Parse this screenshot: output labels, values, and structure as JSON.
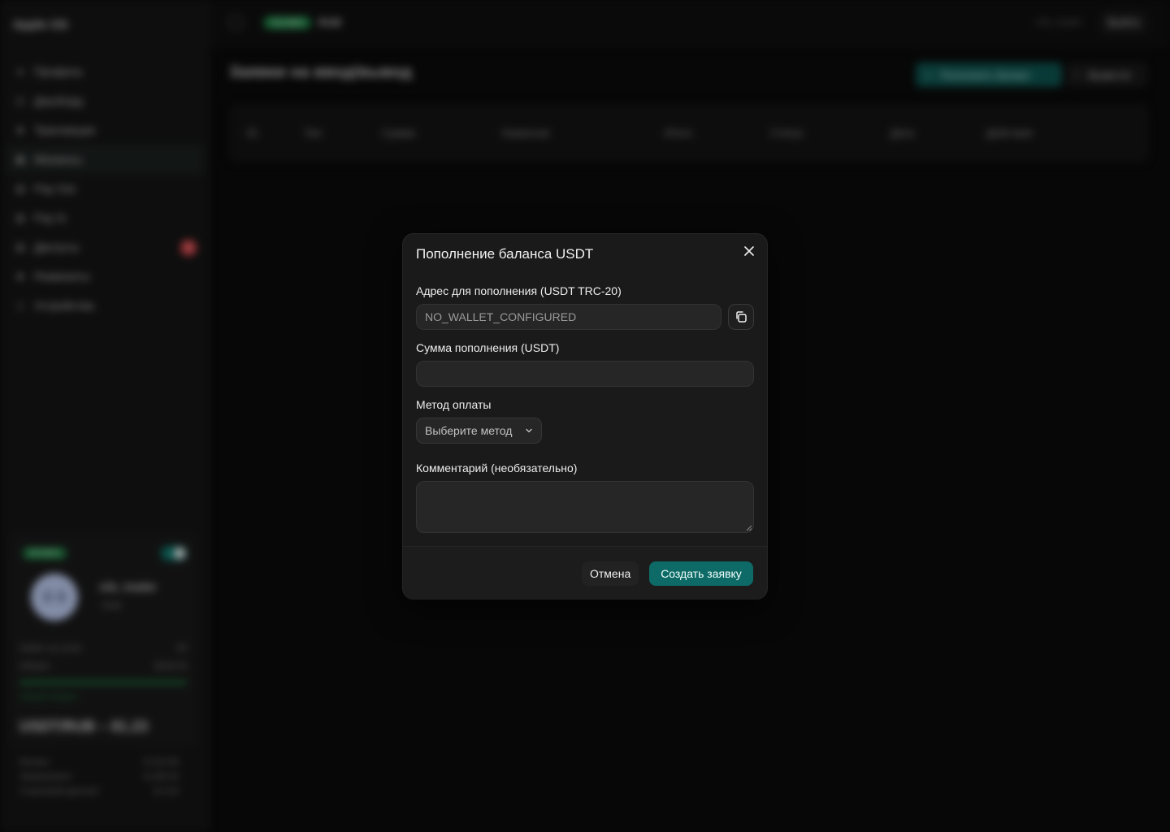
{
  "sidebar": {
    "brand": "Apple OS",
    "items": [
      {
        "label": "Профиль",
        "icon": "user-icon"
      },
      {
        "label": "Дашборд",
        "icon": "dashboard-icon"
      },
      {
        "label": "Транзакции",
        "icon": "transactions-icon"
      },
      {
        "label": "Финансы",
        "icon": "finance-icon",
        "active": true
      },
      {
        "label": "Pay Out",
        "icon": "payout-icon"
      },
      {
        "label": "Pay In",
        "icon": "payin-icon"
      },
      {
        "label": "Диспуты",
        "icon": "dispute-icon",
        "badge": "3"
      },
      {
        "label": "Реквизиты",
        "icon": "requisites-icon"
      },
      {
        "label": "Устройства",
        "icon": "devices-icon"
      }
    ],
    "user_card": {
      "status": "Активен",
      "avatar_initials": "S S",
      "username": "s3s_trader",
      "role": "RUB",
      "rows": [
        {
          "label": "Лимит за сутки",
          "value": "83"
        },
        {
          "label": "Оборот",
          "value": "$226.05"
        }
      ],
      "progress_text": "Новый оборот",
      "rate": "USDT/RUB – 81.23"
    },
    "bottom_stats": [
      {
        "label": "Баланс",
        "value": "$ 323.89"
      },
      {
        "label": "Заморожено",
        "value": "$ 189.00"
      },
      {
        "label": "Страховой депозит",
        "value": "$ 0.00"
      }
    ]
  },
  "topbar": {
    "status_pill": "Онлайн",
    "currency": "RUB",
    "user": "s3s_trader",
    "logout": "Выйти"
  },
  "main": {
    "title": "Заявки на ввод/вывод",
    "topup_button": "Пополнить баланс",
    "withdraw_button": "Вывести",
    "table_headers": [
      "ID",
      "Тип",
      "Сумма",
      "Комиссия",
      "Итого",
      "Статус",
      "Дата",
      "Действия"
    ]
  },
  "modal": {
    "title": "Пополнение баланса USDT",
    "address_label": "Адрес для пополнения (USDT TRC-20)",
    "address_value": "NO_WALLET_CONFIGURED",
    "amount_label": "Сумма пополнения (USDT)",
    "amount_value": "",
    "method_label": "Метод оплаты",
    "method_placeholder": "Выберите метод",
    "comment_label": "Комментарий (необязательно)",
    "cancel": "Отмена",
    "submit": "Создать заявку"
  },
  "colors": {
    "accent": "#0d6a66",
    "success": "#1e8a49",
    "danger": "#e5484d"
  }
}
